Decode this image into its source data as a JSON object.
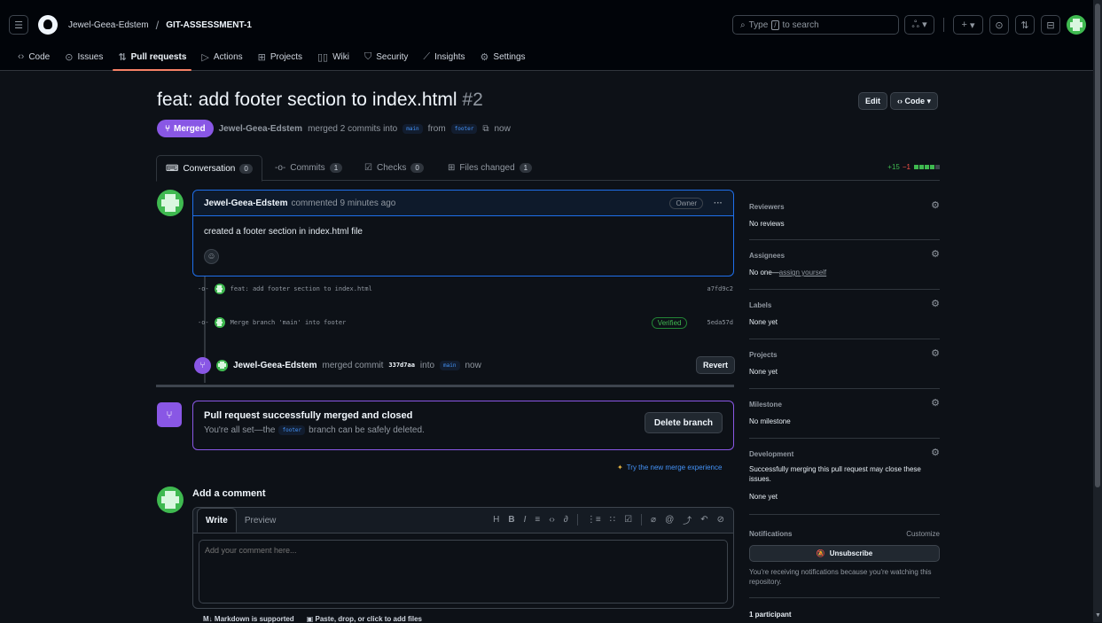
{
  "header": {
    "owner": "Jewel-Geea-Edstem",
    "separator": "/",
    "repo": "GIT-ASSESSMENT-1",
    "search_placeholder": "Type / to search",
    "search_pre": "Type",
    "search_key": "/",
    "search_post": "to search",
    "plus": "+"
  },
  "nav": {
    "code": "Code",
    "issues": "Issues",
    "pull_requests": "Pull requests",
    "actions": "Actions",
    "projects": "Projects",
    "wiki": "Wiki",
    "security": "Security",
    "insights": "Insights",
    "settings": "Settings"
  },
  "pr": {
    "title": "feat: add footer section to index.html",
    "number": "#2",
    "edit_label": "Edit",
    "code_label": "Code",
    "status": "Merged",
    "author": "Jewel-Geea-Edstem",
    "merged_text": "merged 2 commits into",
    "base": "main",
    "from_text": "from",
    "head": "footer",
    "time": "now"
  },
  "tabs": [
    {
      "label": "Conversation",
      "count": "0"
    },
    {
      "label": "Commits",
      "count": "1"
    },
    {
      "label": "Checks",
      "count": "0"
    },
    {
      "label": "Files changed",
      "count": "1"
    }
  ],
  "diffstat": {
    "additions": "+15",
    "deletions": "−1"
  },
  "comment": {
    "author": "Jewel-Geea-Edstem",
    "meta": "commented 9 minutes ago",
    "role": "Owner",
    "more": "···",
    "body": "created a footer section in index.html file"
  },
  "commits": [
    {
      "message": "feat: add footer section to index.html",
      "sha": "a7fd9c2",
      "verified": ""
    },
    {
      "message": "Merge branch 'main' into footer",
      "sha": "5eda57d",
      "verified": "Verified"
    }
  ],
  "merge_event": {
    "author": "Jewel-Geea-Edstem",
    "text": "merged commit",
    "sha": "337d7aa",
    "into": "into",
    "branch": "main",
    "time": "now",
    "revert_label": "Revert"
  },
  "merge_box": {
    "title": "Pull request successfully merged and closed",
    "pre": "You're all set—the",
    "branch": "footer",
    "post": "branch can be safely deleted.",
    "delete_label": "Delete branch",
    "try_new": "Try the new merge experience"
  },
  "add_comment": {
    "heading": "Add a comment",
    "write": "Write",
    "preview": "Preview",
    "placeholder": "Add your comment here...",
    "markdown": "Markdown is supported",
    "paste": "Paste, drop, or click to add files"
  },
  "sidebar": {
    "reviewers": {
      "title": "Reviewers",
      "value": "No reviews"
    },
    "assignees": {
      "title": "Assignees",
      "value": "No one—",
      "link": "assign yourself"
    },
    "labels": {
      "title": "Labels",
      "value": "None yet"
    },
    "projects": {
      "title": "Projects",
      "value": "None yet"
    },
    "milestone": {
      "title": "Milestone",
      "value": "No milestone"
    },
    "development": {
      "title": "Development",
      "value": "Successfully merging this pull request may close these issues.",
      "value2": "None yet"
    },
    "notifications": {
      "title": "Notifications",
      "customize": "Customize",
      "button": "Unsubscribe",
      "note": "You're receiving notifications because you're watching this repository."
    },
    "participants": "1 participant"
  },
  "colors": {
    "merged": "#8957e5",
    "link": "#4493f8",
    "accent_tab": "#f78166",
    "green": "#3fb950"
  }
}
